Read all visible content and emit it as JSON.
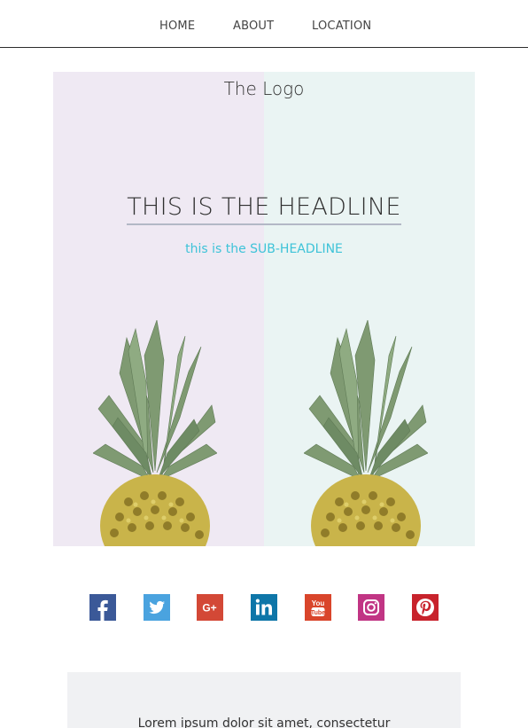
{
  "nav": {
    "items": [
      {
        "label": "HOME"
      },
      {
        "label": "ABOUT"
      },
      {
        "label": "LOCATION"
      }
    ]
  },
  "hero": {
    "logo": "The Logo",
    "headline": "THIS IS THE HEADLINE",
    "subheadline": "this is the SUB-HEADLINE",
    "colors": {
      "left_bg": "#efe9f3",
      "right_bg": "#eaf4f3",
      "subheadline": "#3ec3d8",
      "headline_underline": "#b3b8c6"
    },
    "images": [
      {
        "icon": "pineapple-image"
      },
      {
        "icon": "pineapple-image"
      }
    ]
  },
  "social": {
    "icons": [
      {
        "icon": "facebook-icon",
        "color": "#3b5998"
      },
      {
        "icon": "twitter-icon",
        "color": "#4aa3df"
      },
      {
        "icon": "google-plus-icon",
        "color": "#d34836"
      },
      {
        "icon": "linkedin-icon",
        "color": "#0e76a8"
      },
      {
        "icon": "youtube-icon",
        "color": "#d9452b"
      },
      {
        "icon": "instagram-icon",
        "color": "#c13584"
      },
      {
        "icon": "pinterest-icon",
        "color": "#c8232c"
      }
    ],
    "youtube_text": [
      "You",
      "Tube"
    ]
  },
  "content": {
    "text": "Lorem ipsum dolor sit amet, consectetur"
  }
}
